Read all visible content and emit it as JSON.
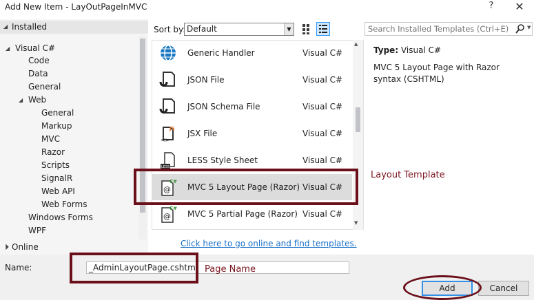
{
  "window": {
    "title": "Add New Item - LayOutPageInMVC",
    "help_glyph": "?",
    "close_glyph": "✕"
  },
  "sidebar": {
    "installed": "Installed",
    "visual_csharp": "Visual C#",
    "items": [
      {
        "label": "Code"
      },
      {
        "label": "Data"
      },
      {
        "label": "General"
      },
      {
        "label": "Web"
      },
      {
        "label": "General"
      },
      {
        "label": "Markup"
      },
      {
        "label": "MVC"
      },
      {
        "label": "Razor"
      },
      {
        "label": "Scripts"
      },
      {
        "label": "SignalR"
      },
      {
        "label": "Web API"
      },
      {
        "label": "Web Forms"
      },
      {
        "label": "Windows Forms"
      },
      {
        "label": "WPF"
      }
    ],
    "online": "Online"
  },
  "toolbar": {
    "sort_label": "Sort by:",
    "sort_value": "Default"
  },
  "templates": [
    {
      "name": "Generic Handler",
      "lang": "Visual C#",
      "icon": "globe-handler-icon"
    },
    {
      "name": "JSON File",
      "lang": "Visual C#",
      "icon": "json-file-icon"
    },
    {
      "name": "JSON Schema File",
      "lang": "Visual C#",
      "icon": "json-schema-icon"
    },
    {
      "name": "JSX File",
      "lang": "Visual C#",
      "icon": "jsx-file-icon"
    },
    {
      "name": "LESS Style Sheet",
      "lang": "Visual C#",
      "icon": "less-file-icon"
    },
    {
      "name": "MVC 5 Layout Page (Razor)",
      "lang": "Visual C#",
      "icon": "razor-layout-icon",
      "selected": true
    },
    {
      "name": "MVC 5 Partial Page (Razor)",
      "lang": "Visual C#",
      "icon": "razor-partial-icon"
    }
  ],
  "search": {
    "placeholder": "Search Installed Templates (Ctrl+E)"
  },
  "details": {
    "type_label": "Type:",
    "type_value": "Visual C#",
    "description": "MVC 5 Layout Page with Razor syntax (CSHTML)"
  },
  "annotations": {
    "layout_template": "Layout Template",
    "page_name": "Page Name"
  },
  "online_link": "Click here to go online and find templates.",
  "name_field": {
    "label": "Name:",
    "value": "_AdminLayoutPage.cshtml"
  },
  "buttons": {
    "add": "Add",
    "cancel": "Cancel"
  },
  "colors": {
    "annotation": "#6b0f1a",
    "link": "#1a6fc7",
    "selection": "#dcdcdc",
    "focus": "#3390e6"
  }
}
